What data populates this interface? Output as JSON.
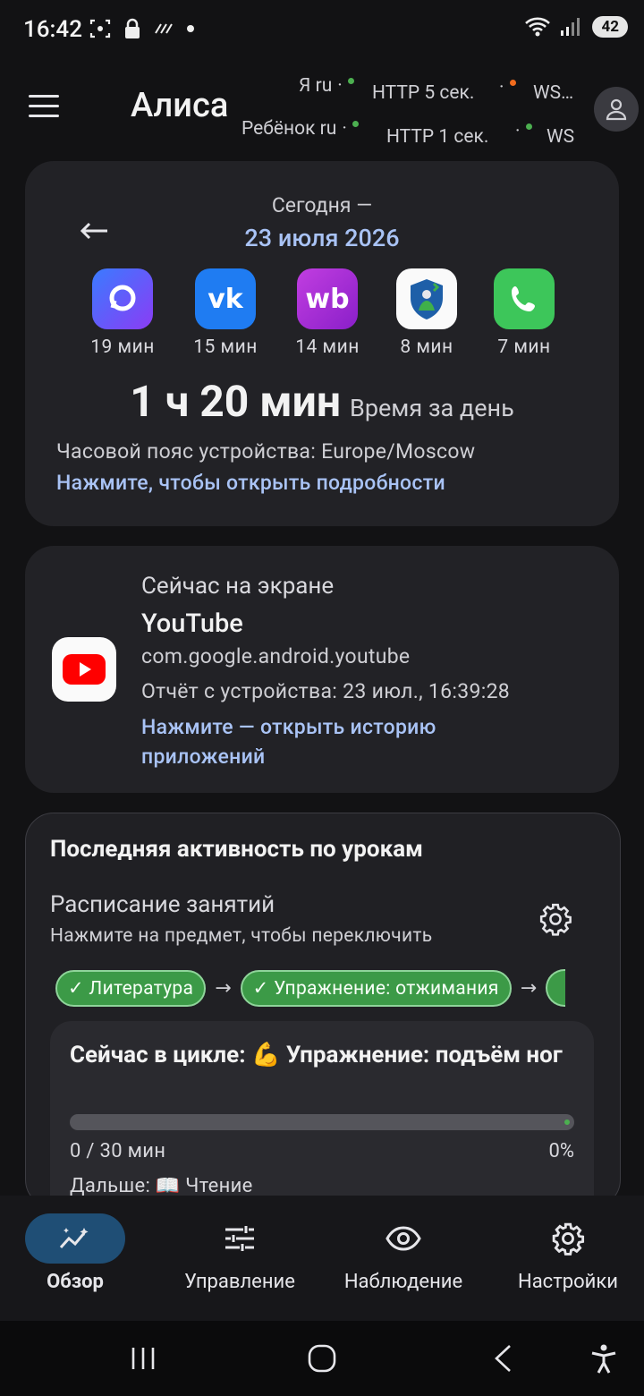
{
  "status_bar": {
    "time": "16:42",
    "battery": "42"
  },
  "header": {
    "title": "Алиса",
    "row1": {
      "label": "Я ru",
      "http": "HTTP 5 сек.",
      "ws": "WS…"
    },
    "row2": {
      "label": "Ребёнок ru",
      "http": "HTTP 1 сек.",
      "ws": "WS"
    },
    "status_colors": {
      "ok": "#4caf50",
      "warn": "#f26b1d"
    }
  },
  "day_card": {
    "today_label": "Сегодня —",
    "date": "23 июля 2026",
    "apps": [
      {
        "icon": "max-messenger-icon",
        "time": "19 мин"
      },
      {
        "icon": "vk-icon",
        "time": "15 мин"
      },
      {
        "icon": "wildberries-icon",
        "time": "14 мин"
      },
      {
        "icon": "shield-family-icon",
        "time": "8 мин"
      },
      {
        "icon": "phone-icon",
        "time": "7 мин"
      }
    ],
    "total": "1 ч 20 мин",
    "total_label": "Время за день",
    "timezone": "Часовой пояс устройства: Europe/Moscow",
    "details_link": "Нажмите, чтобы открыть подробности"
  },
  "now_card": {
    "heading": "Сейчас на экране",
    "app_name": "YouTube",
    "package": "com.google.android.youtube",
    "report": "Отчёт с устройства: 23 июл., 16:39:28",
    "history_link": "Нажмите — открыть историю приложений"
  },
  "lessons_card": {
    "heading": "Последняя активность по урокам",
    "schedule_title": "Расписание занятий",
    "schedule_hint": "Нажмите на предмет, чтобы переключить",
    "chips": [
      "✓ Литература",
      "✓ Упражнение: отжимания"
    ],
    "arrow": "→",
    "cycle_text": "Сейчас в цикле: 💪 Упражнение: подъём ног",
    "progress_text": "0 / 30 мин",
    "progress_percent": "0%",
    "progress_value": 0,
    "next_text": "Дальше: 📖 Чтение"
  },
  "bottom_nav": {
    "items": [
      {
        "label": "Обзор",
        "icon": "chart-sparkle-icon",
        "active": true
      },
      {
        "label": "Управление",
        "icon": "sliders-icon",
        "active": false
      },
      {
        "label": "Наблюдение",
        "icon": "eye-icon",
        "active": false
      },
      {
        "label": "Настройки",
        "icon": "gear-icon",
        "active": false
      }
    ]
  }
}
